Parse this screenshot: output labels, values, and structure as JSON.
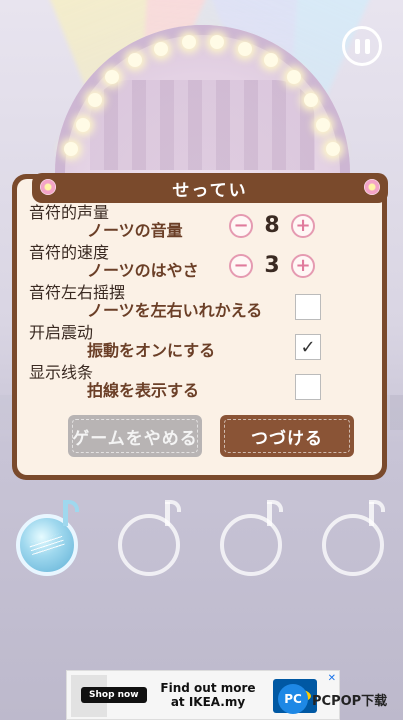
{
  "dialog": {
    "title": "せってい",
    "settings": [
      {
        "label_cn": "音符的声量",
        "label_jp": "ノーツの音量",
        "value": "8"
      },
      {
        "label_cn": "音符的速度",
        "label_jp": "ノーツのはやさ",
        "value": "3"
      },
      {
        "label_cn": "音符左右摇摆",
        "label_jp": "ノーツを左右いれかえる",
        "checked": false
      },
      {
        "label_cn": "开启震动",
        "label_jp": "振動をオンにする",
        "checked": true
      },
      {
        "label_cn": "显示线条",
        "label_jp": "拍線を表示する",
        "checked": false
      }
    ],
    "minus_symbol": "−",
    "plus_symbol": "+",
    "check_mark": "✓",
    "quit_label": "ゲームをやめる",
    "continue_label": "つづける"
  },
  "ad": {
    "shop_label": "Shop now",
    "text": "Find out more at IKEA.my",
    "close_label": "✕"
  },
  "watermark": {
    "logo_text": "PC",
    "text": "PCPOP下载"
  },
  "icons": {
    "pause": "pause-icon",
    "note": "music-note-icon"
  }
}
